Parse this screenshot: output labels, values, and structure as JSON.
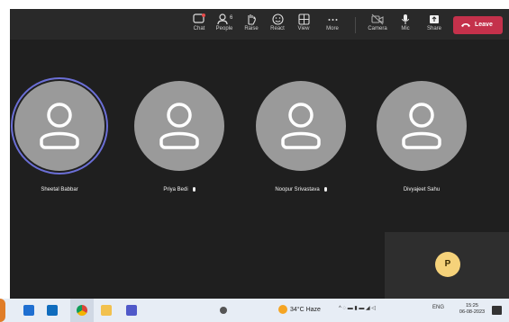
{
  "toolbar": {
    "chat": "Chat",
    "people": "People",
    "people_count": "6",
    "raise": "Raise",
    "react": "React",
    "view": "View",
    "more": "More",
    "camera": "Camera",
    "mic": "Mic",
    "share": "Share",
    "leave": "Leave"
  },
  "participants": [
    {
      "name": "Sheetal Babbar",
      "speaking": true,
      "muted": false
    },
    {
      "name": "Priya Bedi",
      "speaking": false,
      "muted": true
    },
    {
      "name": "Noopur Srivastava",
      "speaking": false,
      "muted": true
    },
    {
      "name": "Divyajeet Sahu",
      "speaking": false,
      "muted": false
    }
  ],
  "self_view": {
    "initial": "P",
    "avatar_color": "#f5d27a"
  },
  "colors": {
    "leave": "#c4314b",
    "active_ring": "#6b6fd6",
    "avatar": "#9a9a9a",
    "app_bg": "#1f1f1f"
  },
  "taskbar": {
    "weather": "34°C  Haze",
    "language": "ENG",
    "time": "15:25",
    "date": "06-08-2023",
    "apps": [
      "start-icon",
      "outlook-icon",
      "chrome-icon",
      "file-explorer-icon",
      "teams-icon",
      "settings-icon"
    ]
  }
}
